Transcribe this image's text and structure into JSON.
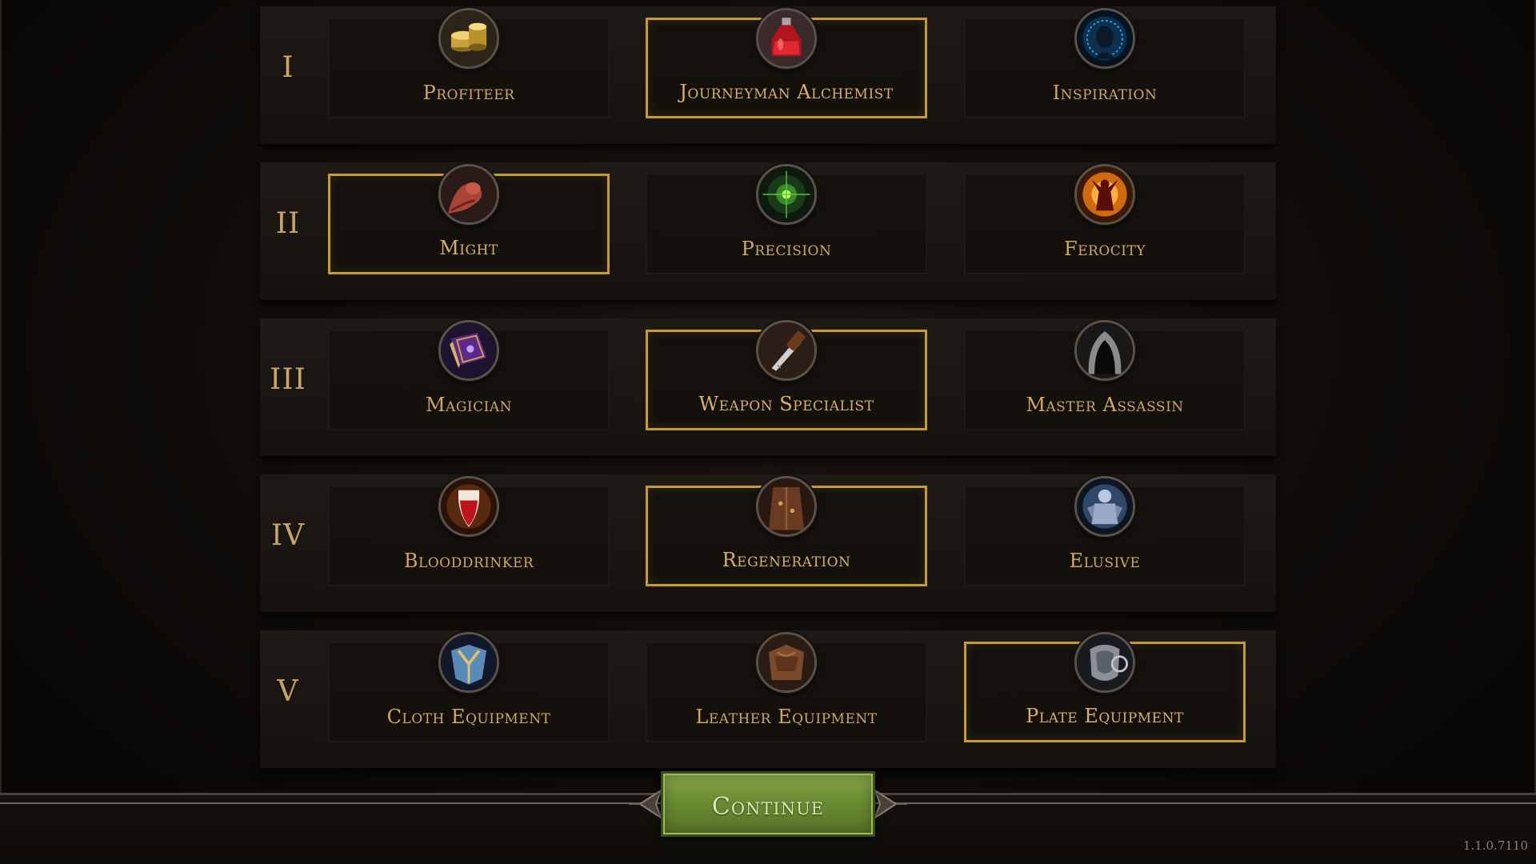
{
  "tiers": [
    {
      "numeral": "I",
      "perks": [
        {
          "label": "Profiteer",
          "icon": "gold-coins-icon",
          "selected": false
        },
        {
          "label": "Journeyman Alchemist",
          "icon": "potion-icon",
          "selected": true
        },
        {
          "label": "Inspiration",
          "icon": "inspiration-head-icon",
          "selected": false
        }
      ]
    },
    {
      "numeral": "II",
      "perks": [
        {
          "label": "Might",
          "icon": "flexed-arm-icon",
          "selected": true
        },
        {
          "label": "Precision",
          "icon": "crosshair-icon",
          "selected": false
        },
        {
          "label": "Ferocity",
          "icon": "rage-figure-icon",
          "selected": false
        }
      ]
    },
    {
      "numeral": "III",
      "perks": [
        {
          "label": "Magician",
          "icon": "spellbook-icon",
          "selected": false
        },
        {
          "label": "Weapon Specialist",
          "icon": "sword-icon",
          "selected": true
        },
        {
          "label": "Master Assassin",
          "icon": "hood-icon",
          "selected": false
        }
      ]
    },
    {
      "numeral": "IV",
      "perks": [
        {
          "label": "Blooddrinker",
          "icon": "blood-fang-icon",
          "selected": false
        },
        {
          "label": "Regeneration",
          "icon": "regeneration-icon",
          "selected": true
        },
        {
          "label": "Elusive",
          "icon": "armored-figure-icon",
          "selected": false
        }
      ]
    },
    {
      "numeral": "V",
      "perks": [
        {
          "label": "Cloth Equipment",
          "icon": "cloth-armor-icon",
          "selected": false
        },
        {
          "label": "Leather Equipment",
          "icon": "leather-armor-icon",
          "selected": false
        },
        {
          "label": "Plate Equipment",
          "icon": "plate-armor-icon",
          "selected": true
        }
      ]
    }
  ],
  "continue_label": "Continue",
  "version": "1.1.0.7110",
  "colors": {
    "selected_border": "#c89a32",
    "label_gold": "#d9b06a",
    "button_green": "#6b8c33"
  }
}
